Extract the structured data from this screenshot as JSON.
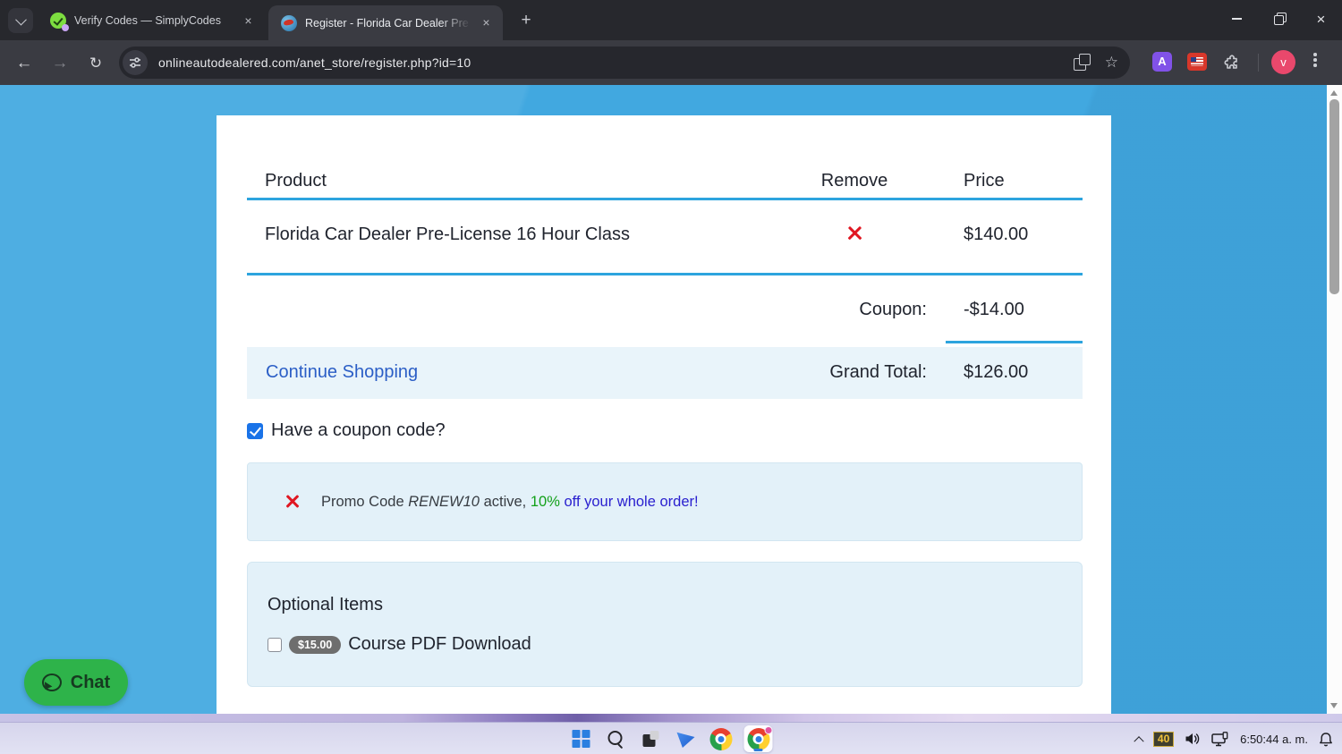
{
  "browser": {
    "tabs": [
      {
        "title": "Verify Codes — SimplyCodes"
      },
      {
        "title": "Register - Florida Car Dealer Pre"
      }
    ],
    "url": "onlineautodealered.com/anet_store/register.php?id=10",
    "profile_initial": "v",
    "extension_a_label": "A"
  },
  "icons": {
    "close": "×",
    "back": "←",
    "forward": "→",
    "reload": "↻",
    "star": "☆",
    "new_tab": "+"
  },
  "cart": {
    "header_product": "Product",
    "header_remove": "Remove",
    "header_price": "Price",
    "items": [
      {
        "name": "Florida Car Dealer Pre-License 16 Hour Class",
        "price": "$140.00"
      }
    ],
    "coupon_label": "Coupon:",
    "coupon_amount": "-$14.00",
    "continue_shopping": "Continue Shopping",
    "grand_total_label": "Grand Total:",
    "grand_total_amount": "$126.00",
    "have_coupon_label": "Have a coupon code?"
  },
  "promo": {
    "prefix": "Promo Code ",
    "code": "RENEW10",
    "middle": " active, ",
    "percent": "10%",
    "suffix": " off your whole order!"
  },
  "optional": {
    "title": "Optional Items",
    "price_badge": "$15.00",
    "item_label": "Course PDF Download"
  },
  "chat": {
    "label": "Chat"
  },
  "taskbar": {
    "indicator": "40",
    "time": "6:50:44 a. m."
  },
  "colors": {
    "page_background": "#41a8e0",
    "accent_rule": "#2da4de",
    "link_blue": "#2b5ec6",
    "promo_blue": "#2a20cf",
    "promo_green": "#12a019",
    "alert_red": "#e01722",
    "checkbox_blue": "#1a73e8",
    "chat_green": "#2eb34a"
  }
}
